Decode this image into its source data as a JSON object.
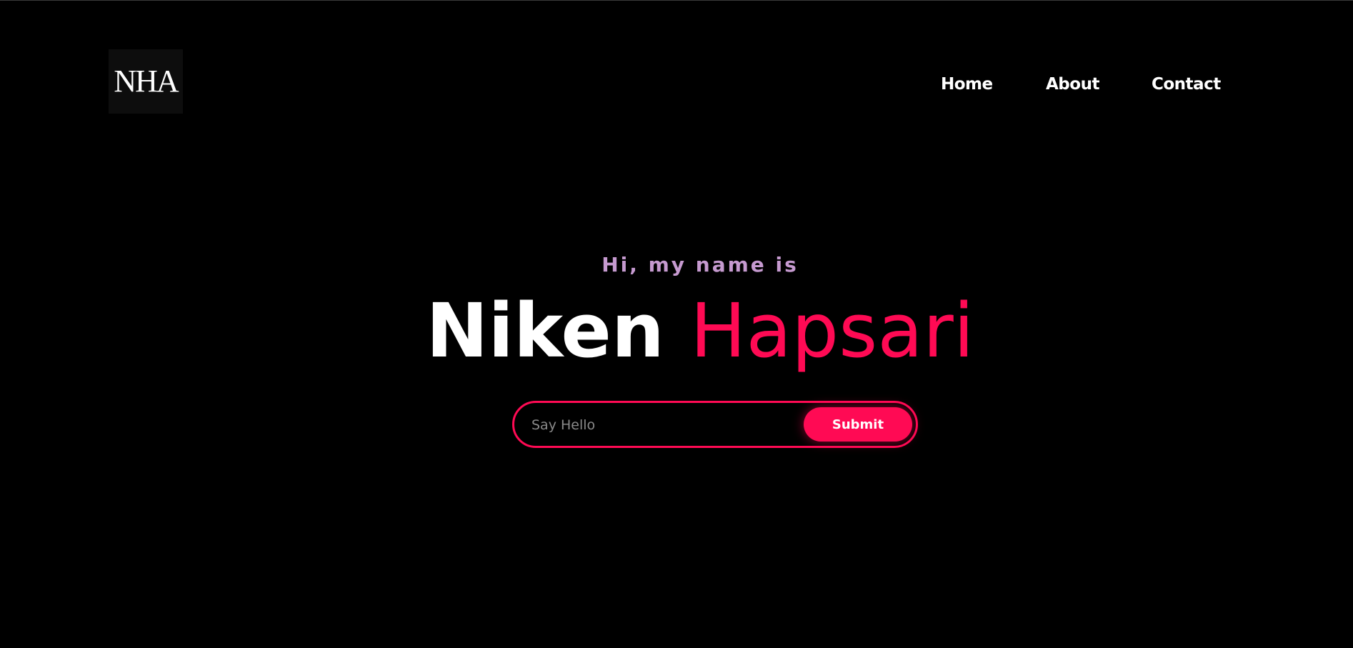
{
  "logo": {
    "text": "NHA"
  },
  "nav": {
    "items": [
      {
        "label": "Home"
      },
      {
        "label": "About"
      },
      {
        "label": "Contact"
      }
    ]
  },
  "hero": {
    "intro": "Hi, my name is",
    "first_name": "Niken",
    "last_name": "Hapsari"
  },
  "form": {
    "placeholder": "Say Hello",
    "value": "",
    "submit_label": "Submit"
  },
  "colors": {
    "background": "#000000",
    "accent": "#ff0a54",
    "intro": "#c69ad0",
    "text": "#ffffff"
  }
}
